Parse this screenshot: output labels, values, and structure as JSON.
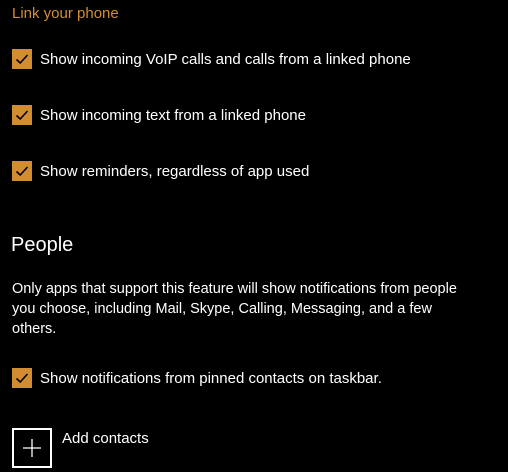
{
  "colors": {
    "accent": "#d28d32",
    "background": "#000000",
    "text": "#ffffff"
  },
  "link_phone": {
    "heading": "Link your phone",
    "options": [
      {
        "label": "Show incoming VoIP calls and calls from a linked phone",
        "checked": true
      },
      {
        "label": "Show incoming text from a linked phone",
        "checked": true
      },
      {
        "label": "Show reminders, regardless of app used",
        "checked": true
      }
    ]
  },
  "people": {
    "heading": "People",
    "description": "Only apps that support this feature will show notifications from people you choose, including Mail, Skype, Calling, Messaging, and a few others.",
    "pinned_option": {
      "label": "Show notifications from pinned contacts on taskbar.",
      "checked": true
    },
    "add_contacts": {
      "label": "Add contacts",
      "icon": "plus-icon"
    }
  }
}
